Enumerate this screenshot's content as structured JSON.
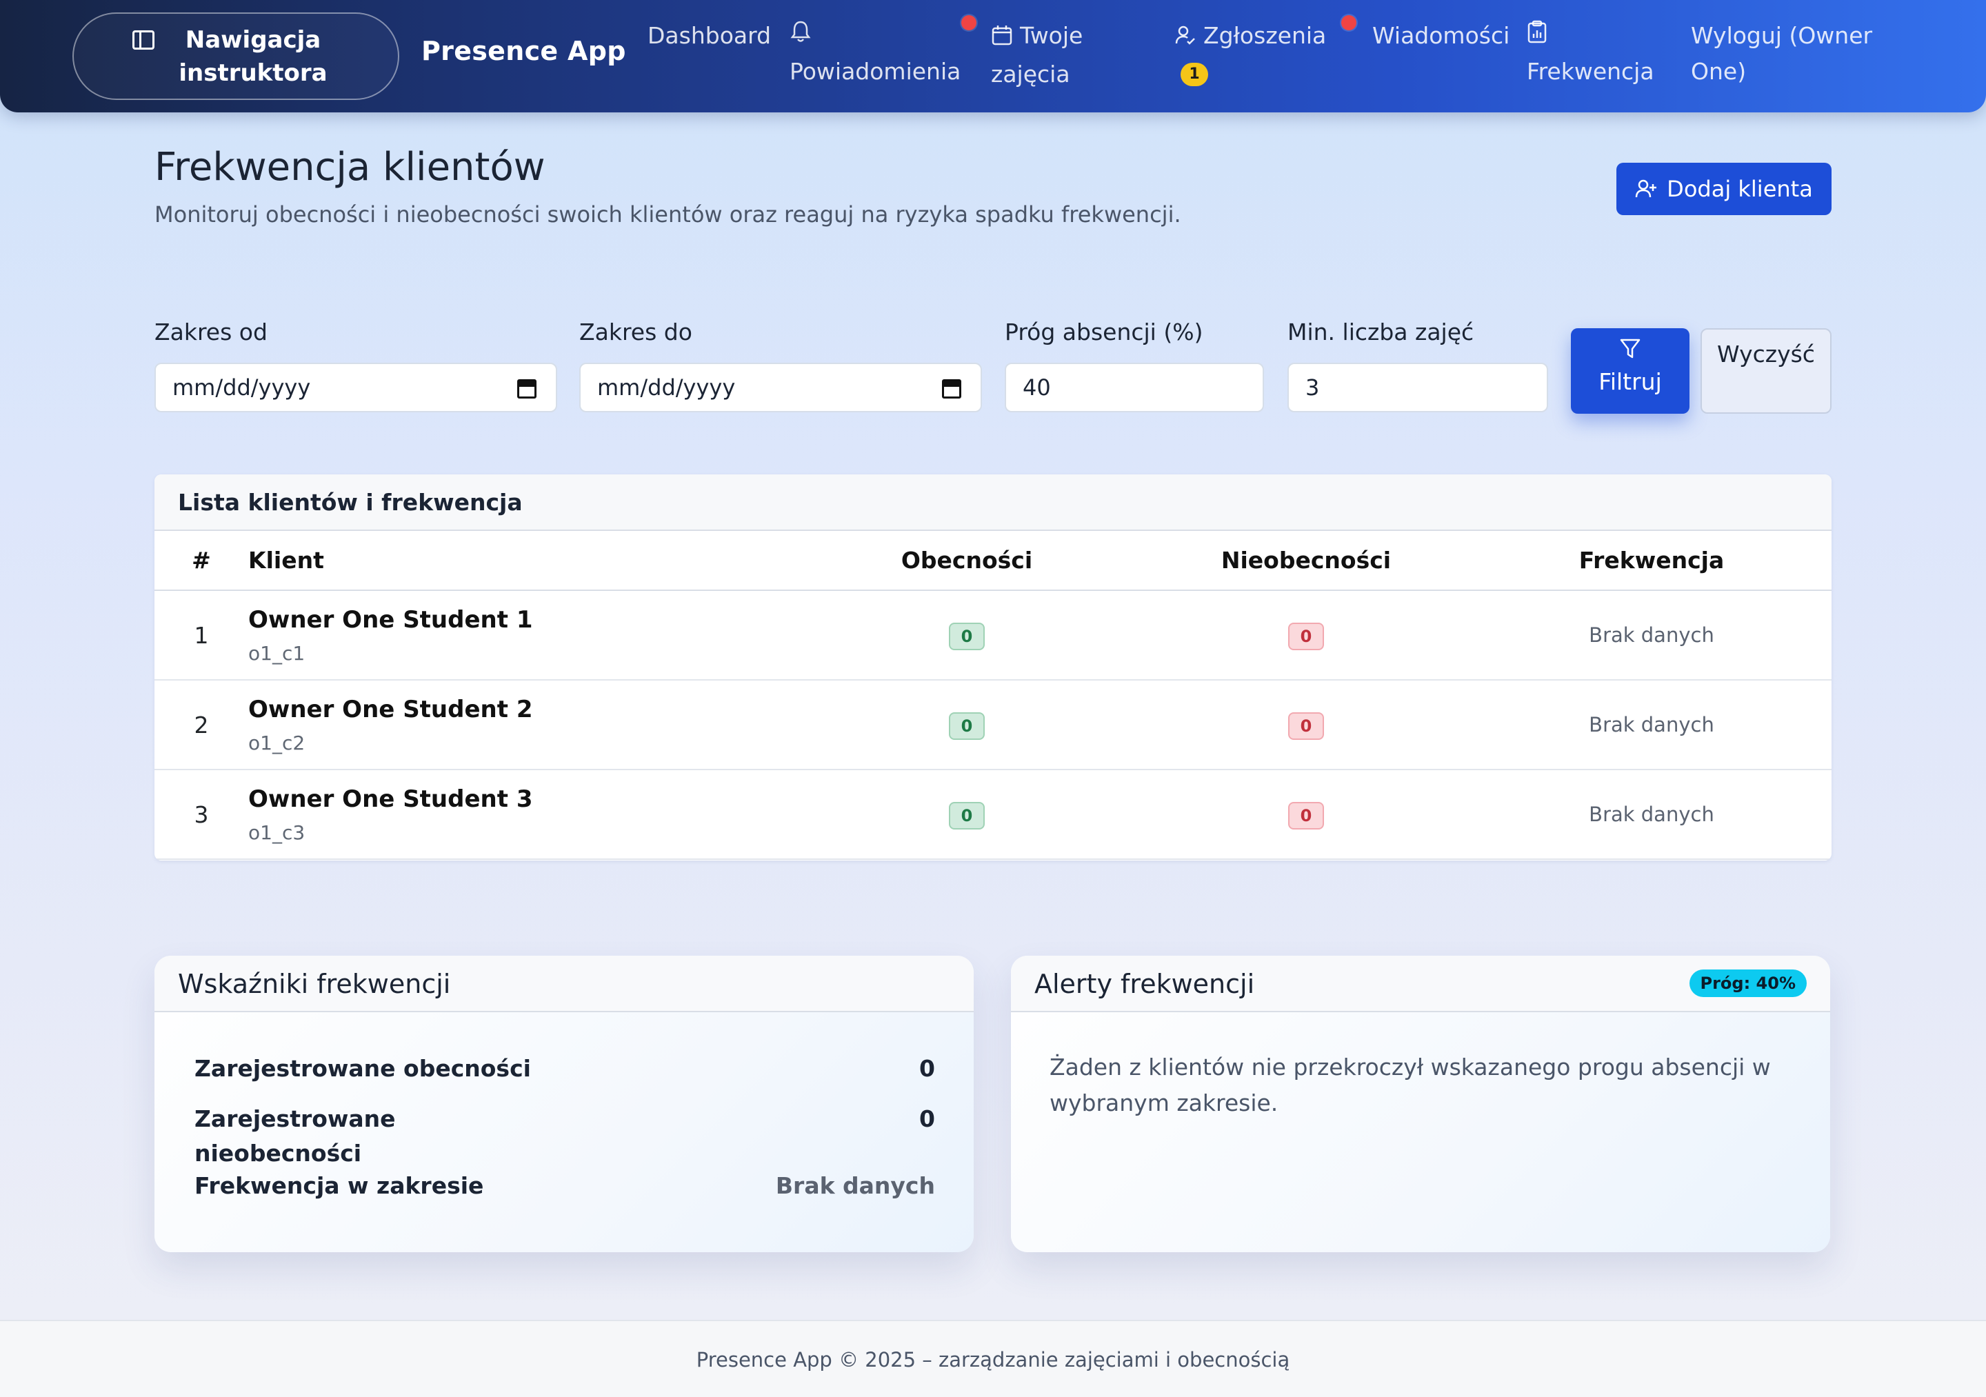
{
  "navbar": {
    "toggle_label": "Nawigacja instruktora",
    "brand": "Presence App",
    "links": {
      "dashboard": "Dashboard",
      "notifications": "Powiadomienia",
      "classes": "Twoje zajęcia",
      "requests": "Zgłoszenia",
      "requests_count": "1",
      "messages": "Wiadomości",
      "attendance": "Frekwencja",
      "logout": "Wyloguj (Owner One)"
    },
    "colors": {
      "badge_dot": "#ef4444",
      "count_badge": "#f5c518"
    }
  },
  "header": {
    "title": "Frekwencja klientów",
    "subtitle": "Monitoruj obecności i nieobecności swoich klientów oraz reaguj na ryzyka spadku frekwencji.",
    "add_button": "Dodaj klienta"
  },
  "filters": {
    "date_from": {
      "label": "Zakres od",
      "placeholder": "mm/dd/yyyy"
    },
    "date_to": {
      "label": "Zakres do",
      "placeholder": "mm/dd/yyyy"
    },
    "threshold": {
      "label": "Próg absencji (%)",
      "value": "40"
    },
    "min_classes": {
      "label": "Min. liczba zajęć",
      "value": "3"
    },
    "filter_button": "Filtruj",
    "clear_button": "Wyczyść"
  },
  "table": {
    "title": "Lista klientów i frekwencja",
    "columns": {
      "num": "#",
      "client": "Klient",
      "presences": "Obecności",
      "absences": "Nieobecności",
      "attendance": "Frekwencja"
    },
    "rows": [
      {
        "num": "1",
        "name": "Owner One Student 1",
        "login": "o1_c1",
        "presences": "0",
        "absences": "0",
        "attendance": "Brak danych"
      },
      {
        "num": "2",
        "name": "Owner One Student 2",
        "login": "o1_c2",
        "presences": "0",
        "absences": "0",
        "attendance": "Brak danych"
      },
      {
        "num": "3",
        "name": "Owner One Student 3",
        "login": "o1_c3",
        "presences": "0",
        "absences": "0",
        "attendance": "Brak danych"
      }
    ]
  },
  "metrics": {
    "title": "Wskaźniki frekwencji",
    "presences_label": "Zarejestrowane obecności",
    "presences_value": "0",
    "absences_label_line1": "Zarejestrowane",
    "absences_label_line2": "nieobecności",
    "absences_value": "0",
    "range_label": "Frekwencja w zakresie",
    "range_value": "Brak danych"
  },
  "alerts": {
    "title": "Alerty frekwencji",
    "badge": "Próg: 40%",
    "message": "Żaden z klientów nie przekroczył wskazanego progu absencji w wybranym zakresie."
  },
  "footer": {
    "text": "Presence App © 2025 – zarządzanie zajęciami i obecnością"
  }
}
